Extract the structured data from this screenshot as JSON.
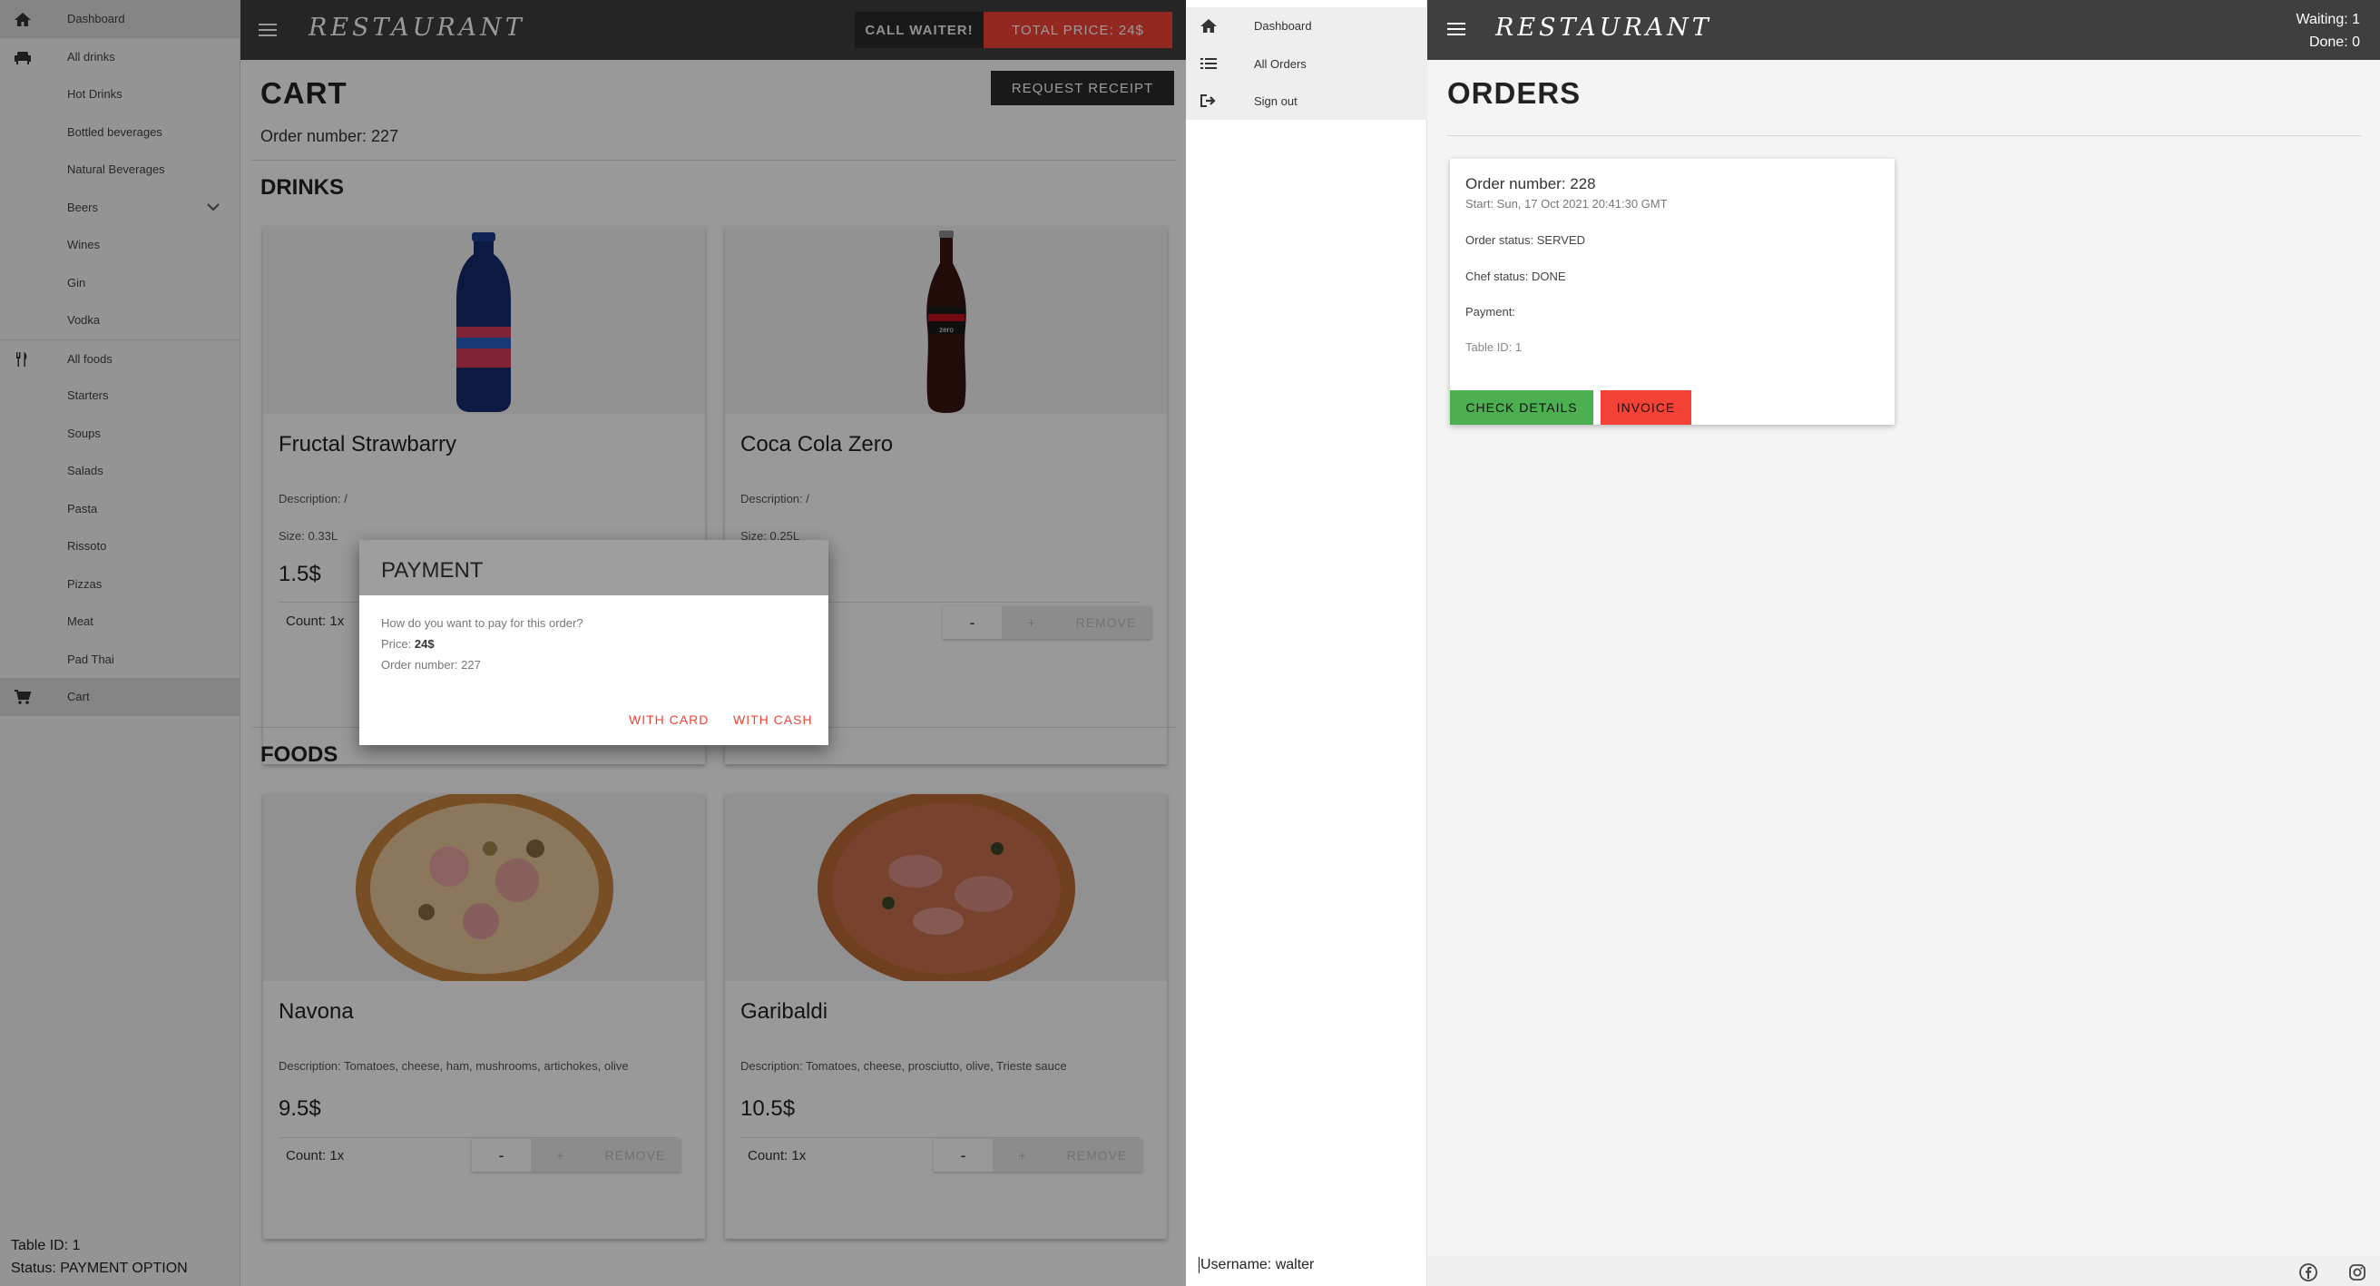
{
  "left_app": {
    "sidebar": {
      "items": [
        {
          "label": "Dashboard",
          "icon": "home-icon"
        },
        {
          "label": "All drinks",
          "icon": "sofa-icon"
        },
        {
          "label": "Hot Drinks"
        },
        {
          "label": "Bottled beverages"
        },
        {
          "label": "Natural Beverages"
        },
        {
          "label": "Beers",
          "icon": "chevron-down-icon"
        },
        {
          "label": "Wines"
        },
        {
          "label": "Gin"
        },
        {
          "label": "Vodka"
        },
        {
          "label": "All foods",
          "icon": "cutlery-icon"
        },
        {
          "label": "Starters"
        },
        {
          "label": "Soups"
        },
        {
          "label": "Salads"
        },
        {
          "label": "Pasta"
        },
        {
          "label": "Rissoto"
        },
        {
          "label": "Pizzas"
        },
        {
          "label": "Meat"
        },
        {
          "label": "Pad Thai"
        },
        {
          "label": "Cart",
          "icon": "cart-icon"
        }
      ],
      "footer": {
        "table_id": "Table ID: 1",
        "status": "Status: PAYMENT OPTION"
      }
    },
    "header": {
      "logo": "RESTAURANT",
      "call_waiter": "CALL WAITER!",
      "total_price": "TOTAL PRICE: 24$"
    },
    "cart": {
      "title": "CART",
      "request_receipt": "REQUEST RECEIPT",
      "order_number": "Order number: 227",
      "drinks_title": "DRINKS",
      "foods_title": "FOODS",
      "drinks": [
        {
          "name": "Fructal Strawbarry",
          "description": "Description: /",
          "size": "Size: 0.33L",
          "price": "1.5$",
          "count": "Count: 1x"
        },
        {
          "name": "Coca Cola Zero",
          "description": "Description: /",
          "size": "Size: 0.25L",
          "price": "",
          "count": ""
        }
      ],
      "foods": [
        {
          "name": "Navona",
          "description": "Description: Tomatoes, cheese, ham, mushrooms, artichokes, olive",
          "price": "9.5$",
          "count": "Count: 1x"
        },
        {
          "name": "Garibaldi",
          "description": "Description: Tomatoes, cheese, prosciutto, olive, Trieste sauce",
          "price": "10.5$",
          "count": "Count: 1x"
        }
      ],
      "buttons": {
        "minus": "-",
        "plus": "+",
        "remove": "REMOVE"
      }
    },
    "payment_dialog": {
      "title": "PAYMENT",
      "question": "How do you want to pay for this order?",
      "price_label": "Price:",
      "price_value": "24$",
      "order_number": "Order number: 227",
      "with_card": "WITH CARD",
      "with_cash": "WITH CASH"
    }
  },
  "right_app": {
    "sidebar": {
      "items": [
        {
          "label": "Dashboard",
          "icon": "home-icon"
        },
        {
          "label": "All Orders",
          "icon": "list-icon"
        },
        {
          "label": "Sign out",
          "icon": "sign-out-icon"
        }
      ],
      "username": "Username: walter"
    },
    "header": {
      "logo": "RESTAURANT",
      "waiting": "Waiting: 1",
      "done": "Done: 0"
    },
    "orders": {
      "title": "ORDERS",
      "card": {
        "order_number": "Order number: 228",
        "start": "Start: Sun, 17 Oct 2021 20:41:30 GMT",
        "order_status": "Order status: SERVED",
        "chef_status": "Chef status: DONE",
        "payment": "Payment:",
        "table_id": "Table ID: 1",
        "check_details": "CHECK DETAILS",
        "invoice": "INVOICE"
      }
    },
    "footer": {
      "icons": [
        "facebook-icon",
        "instagram-icon"
      ]
    }
  },
  "colors": {
    "header_bg": "#3f3f3f",
    "accent_red": "#f44336",
    "accent_green": "#4caf50"
  }
}
